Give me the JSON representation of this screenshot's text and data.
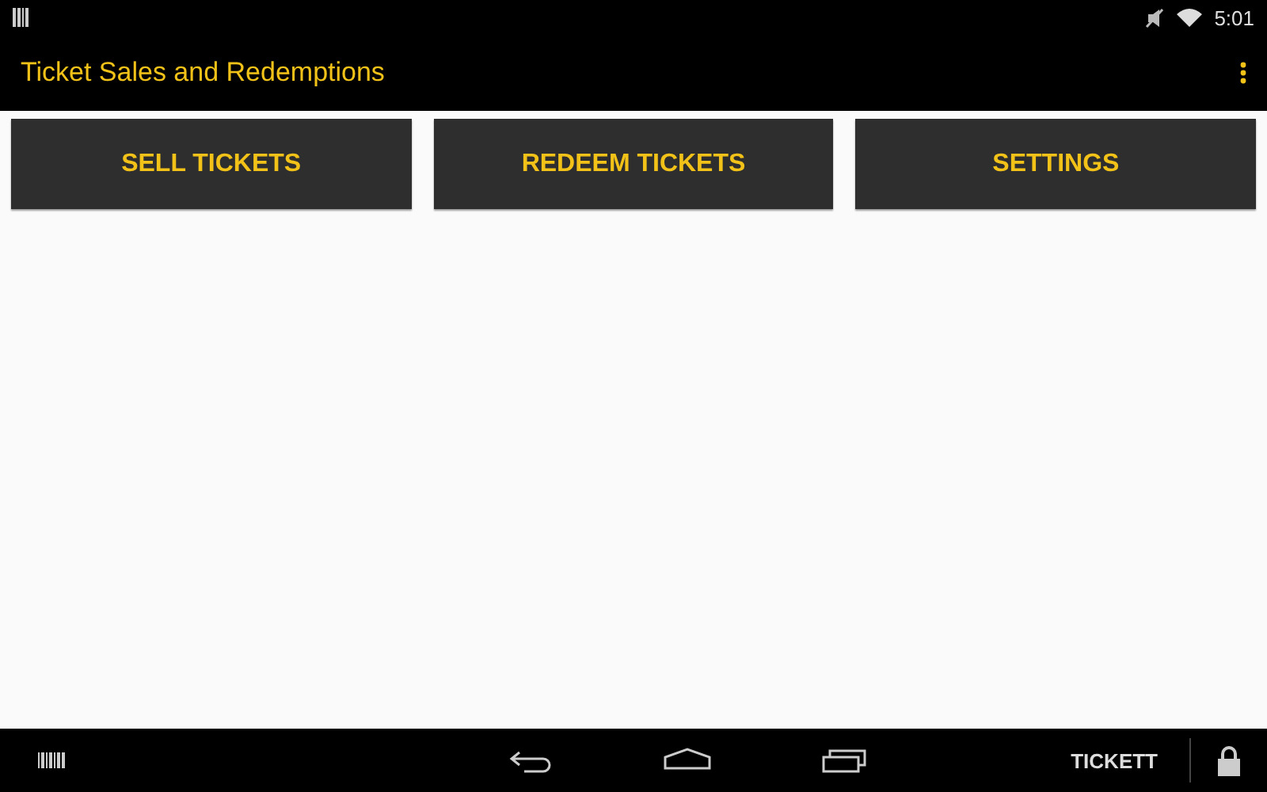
{
  "status_bar": {
    "time": "5:01"
  },
  "action_bar": {
    "title": "Ticket Sales and Redemptions"
  },
  "buttons": [
    "SELL TICKETS",
    "REDEEM TICKETS",
    "SETTINGS"
  ],
  "nav_bar": {
    "app_label": "TICKETT"
  }
}
